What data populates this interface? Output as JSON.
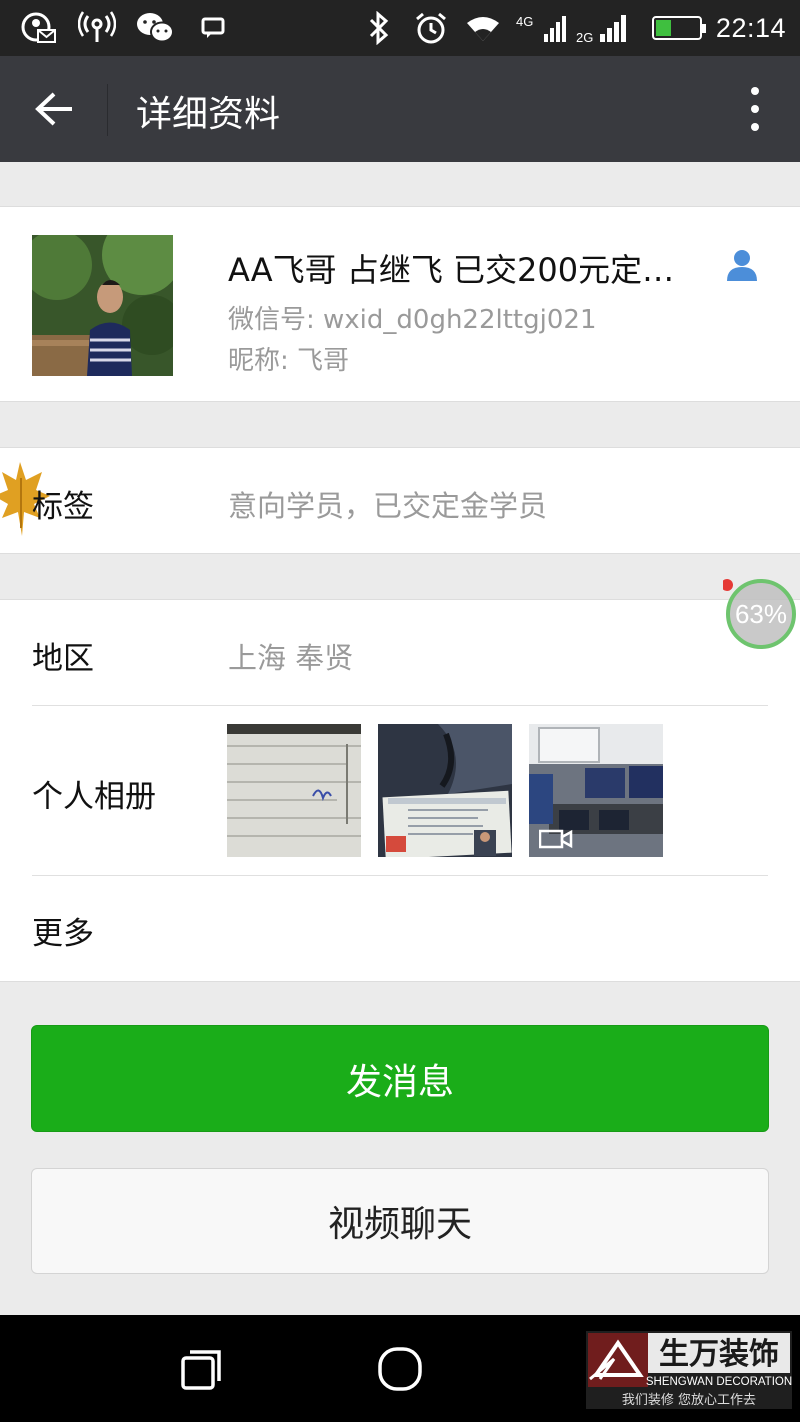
{
  "status_bar": {
    "time": "22:14",
    "network_labels": [
      "4G",
      "2G"
    ],
    "battery_percent": 35,
    "icons": [
      "contact-sync-icon",
      "wifi-hotspot-icon",
      "wechat-icon",
      "message-icon",
      "bluetooth-icon",
      "alarm-icon",
      "wifi-icon",
      "signal-icon",
      "battery-icon"
    ]
  },
  "header": {
    "title": "详细资料"
  },
  "profile": {
    "name": "AA飞哥  占继飞  已交200元定…",
    "wechat_id": "微信号: wxid_d0gh22lttgj021",
    "nickname": "昵称: 飞哥"
  },
  "tags_row": {
    "label": "标签",
    "value": "意向学员，已交定金学员"
  },
  "region_row": {
    "label": "地区",
    "value": "上海  奉贤"
  },
  "album_row": {
    "label": "个人相册",
    "photos": [
      "photo-document",
      "photo-certificate",
      "photo-classroom-video"
    ]
  },
  "more_row": {
    "label": "更多"
  },
  "actions": {
    "send_message": "发消息",
    "video_chat": "视频聊天"
  },
  "floating_badge": {
    "percent": "63%"
  },
  "watermark": {
    "brand": "生万装饰",
    "english": "SHENGWAN DECORATION",
    "slogan": "我们装修  您放心工作去"
  },
  "colors": {
    "accent_green": "#1aad19",
    "app_bar": "#393a3f",
    "status_bar": "#232323"
  }
}
